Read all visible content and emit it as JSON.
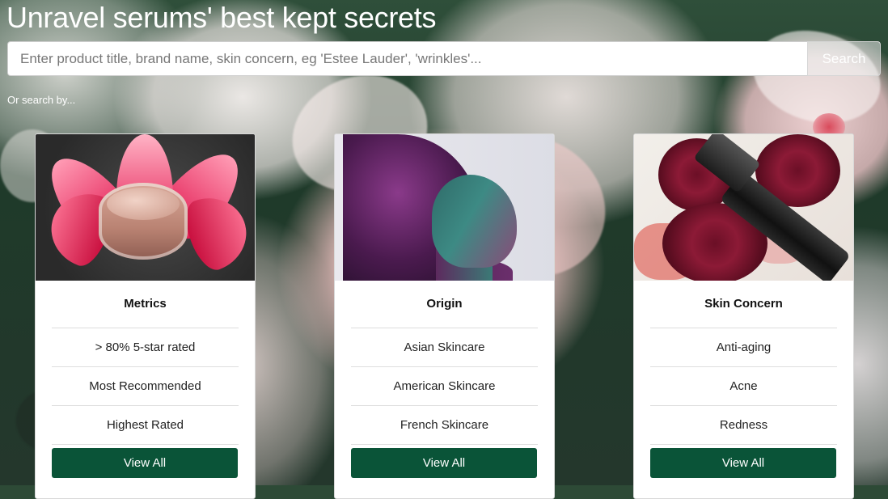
{
  "page": {
    "title": "Unravel serums' best kept secrets",
    "search": {
      "placeholder": "Enter product title, brand name, skin concern, eg 'Estee Lauder', 'wrinkles'...",
      "value": "",
      "button_label": "Search"
    },
    "or_search_by": "Or search by..."
  },
  "cards": [
    {
      "image": "cream-jar-on-pink-flower",
      "title": "Metrics",
      "items": [
        "> 80% 5-star rated",
        "Most Recommended",
        "Highest Rated"
      ],
      "button_label": "View All"
    },
    {
      "image": "portrait-teal-magenta-lighting",
      "title": "Origin",
      "items": [
        "Asian Skincare",
        "American Skincare",
        "French Skincare"
      ],
      "button_label": "View All"
    },
    {
      "image": "dried-roses-with-serum-bottle",
      "title": "Skin Concern",
      "items": [
        "Anti-aging",
        "Acne",
        "Redness"
      ],
      "button_label": "View All"
    }
  ],
  "colors": {
    "button_bg": "#0a5438",
    "button_text": "#ffffff",
    "title_text": "#ffffff"
  }
}
